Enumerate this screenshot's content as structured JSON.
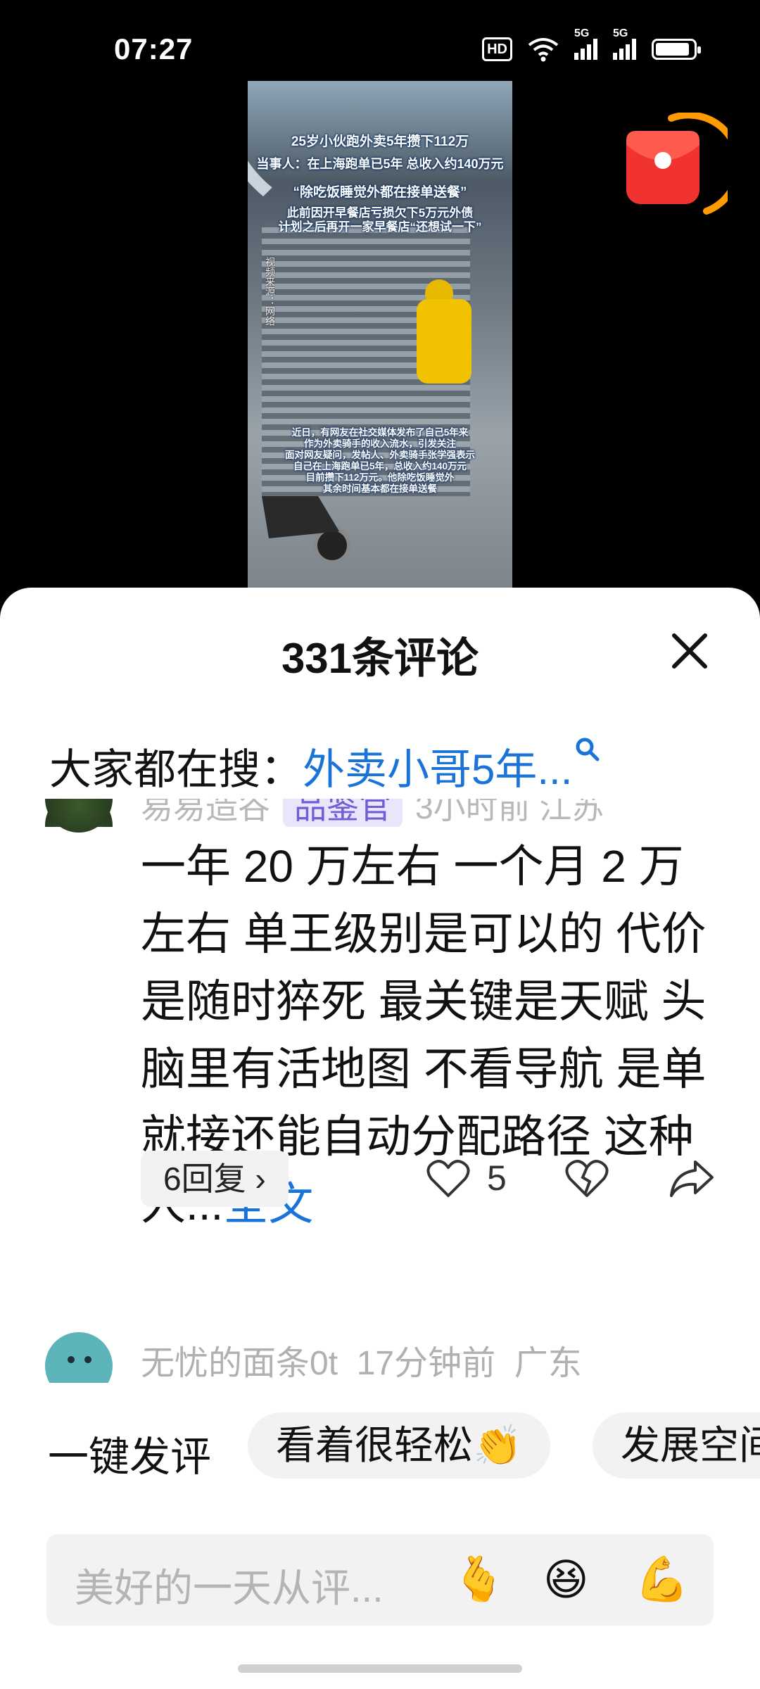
{
  "status_bar": {
    "time": "07:27",
    "hd_label": "HD",
    "network": "5G",
    "battery_level": 0.9
  },
  "video": {
    "captions": [
      "25岁小伙跑外卖5年攒下112万",
      "当事人：在上海跑单已5年 总收入约140万元",
      "“除吃饭睡觉外都在接单送餐”",
      "此前因开早餐店亏损欠下5万元外债",
      "计划之后再开一家早餐店“还想试一下”"
    ],
    "side_text": "视频来源：网络",
    "bottom_caption": [
      "近日，有网友在社交媒体发布了自己5年来",
      "作为外卖骑手的收入流水，引发关注",
      "面对网友疑问，发帖人、外卖骑手张学强表示",
      "自己在上海跑单已5年，总收入约140万元",
      "目前攒下112万元。他除吃饭睡觉外",
      "其余时间基本都在接单送餐"
    ]
  },
  "sheet": {
    "title": "331条评论",
    "search_label": "大家都在搜：",
    "search_keyword": "外卖小哥5年...",
    "comment1": {
      "username": "易易造谷",
      "badge": "品鉴官",
      "time_location": "3小时前 江苏",
      "text": "一年 20 万左右 一个月 2 万左右 单王级别是可以的 代价是随时猝死 最关键是天赋 头脑里有活地图 不看导航 是单就接还能自动分配路径 这种人...",
      "more_label": "全文",
      "replies_label": "6回复",
      "like_count": "5"
    },
    "comment2": {
      "username": "无忧的面条0t",
      "time": "17分钟前",
      "location": "广东"
    },
    "quick_comment_label": "一键发评",
    "quick_chips": [
      "看着很轻松👏",
      "发展空间"
    ],
    "input_placeholder": "美好的一天从评...",
    "emojis": [
      "🫰",
      "😆",
      "💪"
    ]
  }
}
